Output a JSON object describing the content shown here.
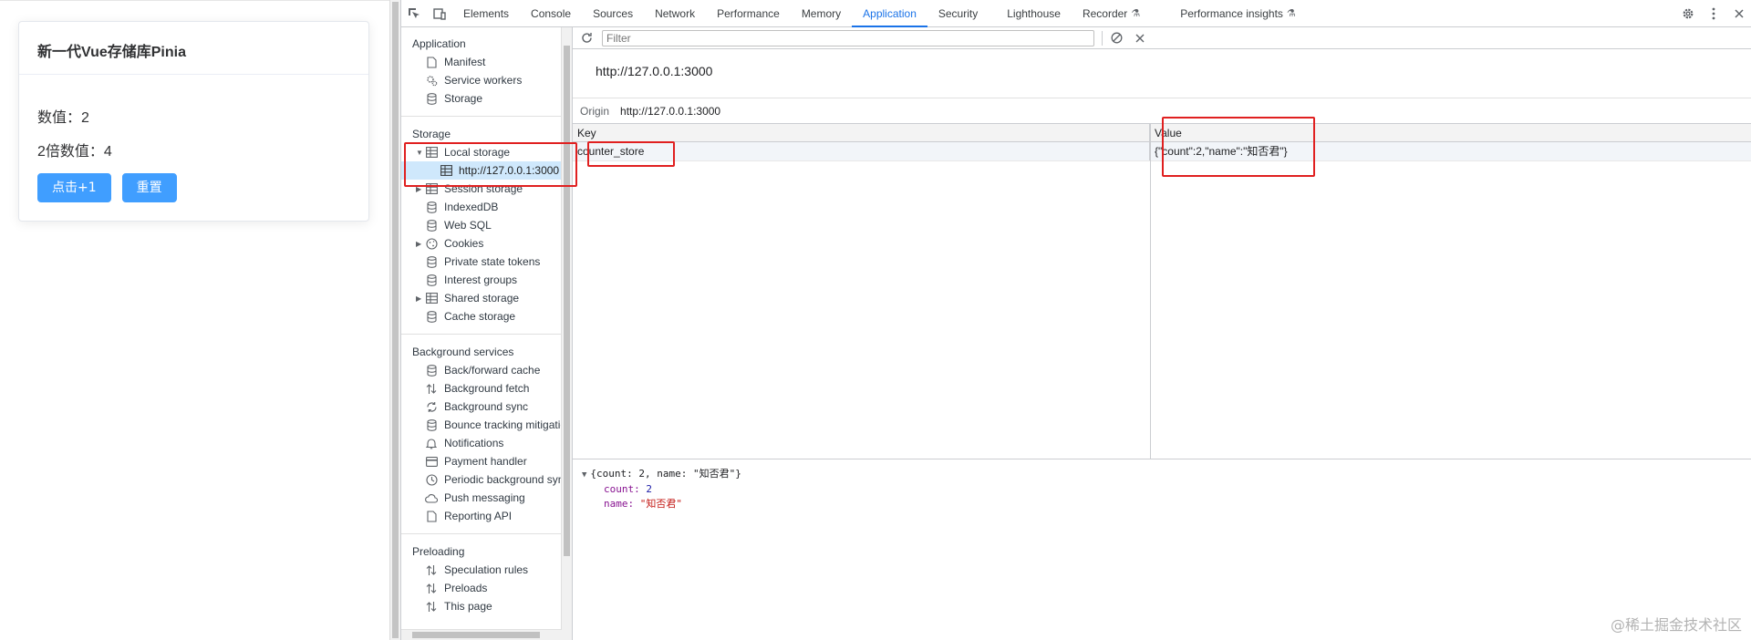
{
  "app_page": {
    "card_title": "新一代Vue存储库Pinia",
    "count_line": "数值：2",
    "double_line": "2倍数值：4",
    "btn_increment": "点击+1",
    "btn_reset": "重置"
  },
  "devtools": {
    "tabs": [
      {
        "label": "Elements"
      },
      {
        "label": "Console"
      },
      {
        "label": "Sources"
      },
      {
        "label": "Network"
      },
      {
        "label": "Performance"
      },
      {
        "label": "Memory"
      },
      {
        "label": "Application"
      },
      {
        "label": "Security"
      },
      {
        "label": "Lighthouse"
      },
      {
        "label": "Recorder"
      },
      {
        "label": "Performance insights"
      }
    ],
    "active_tab": "Application",
    "sidebar": {
      "application_title": "Application",
      "application_items": [
        "Manifest",
        "Service workers",
        "Storage"
      ],
      "storage_title": "Storage",
      "local_storage": "Local storage",
      "local_storage_origin": "http://127.0.0.1:3000",
      "storage_items": [
        "Session storage",
        "IndexedDB",
        "Web SQL",
        "Cookies",
        "Private state tokens",
        "Interest groups",
        "Shared storage",
        "Cache storage"
      ],
      "background_title": "Background services",
      "background_items": [
        "Back/forward cache",
        "Background fetch",
        "Background sync",
        "Bounce tracking mitigatic",
        "Notifications",
        "Payment handler",
        "Periodic background sync",
        "Push messaging",
        "Reporting API"
      ],
      "preloading_title": "Preloading",
      "preloading_items": [
        "Speculation rules",
        "Preloads",
        "This page"
      ]
    },
    "toolbar": {
      "filter_placeholder": "Filter"
    },
    "main": {
      "origin_heading": "http://127.0.0.1:3000",
      "origin_label": "Origin",
      "origin_value": "http://127.0.0.1:3000",
      "col_key": "Key",
      "col_value": "Value",
      "row_key": "counter_store",
      "row_value": "{\"count\":2,\"name\":\"知否君\"}",
      "preview_summary": "{count: 2, name: \"知否君\"}",
      "preview_count_key": "count:",
      "preview_count_val": "2",
      "preview_name_key": "name:",
      "preview_name_val": "\"知否君\""
    }
  },
  "watermark": "@稀土掘金技术社区",
  "colors": {
    "accent": "#1a73e8",
    "button": "#409eff",
    "highlight": "#e02020"
  }
}
